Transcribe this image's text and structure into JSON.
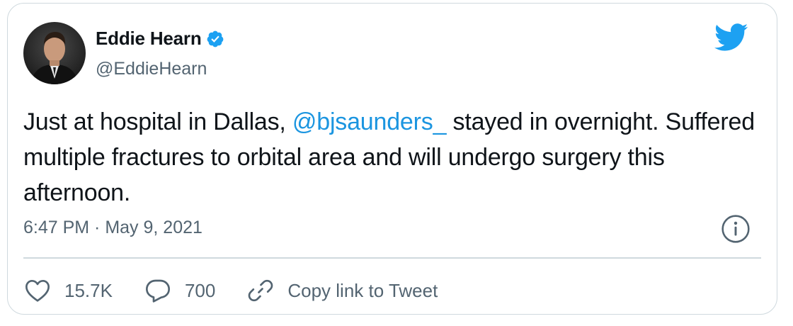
{
  "author": {
    "name": "Eddie Hearn",
    "handle": "@EddieHearn",
    "verified": true
  },
  "tweet": {
    "text_before": "Just at hospital in Dallas, ",
    "mention": "@bjsaunders_",
    "text_after": " stayed in overnight. Suffered multiple fractures to orbital area and will undergo surgery this afternoon."
  },
  "meta": {
    "timestamp": "6:47 PM · May 9, 2021"
  },
  "actions": {
    "likes": "15.7K",
    "replies": "700",
    "copy_link_label": "Copy link to Tweet"
  },
  "colors": {
    "accent": "#1b95e0",
    "text": "#0f1419",
    "muted": "#536471",
    "border": "#cfd9de",
    "twitter_blue": "#1da1f2"
  },
  "icons": [
    "verified-badge-icon",
    "twitter-bird-icon",
    "info-icon",
    "heart-icon",
    "reply-icon",
    "link-icon"
  ]
}
